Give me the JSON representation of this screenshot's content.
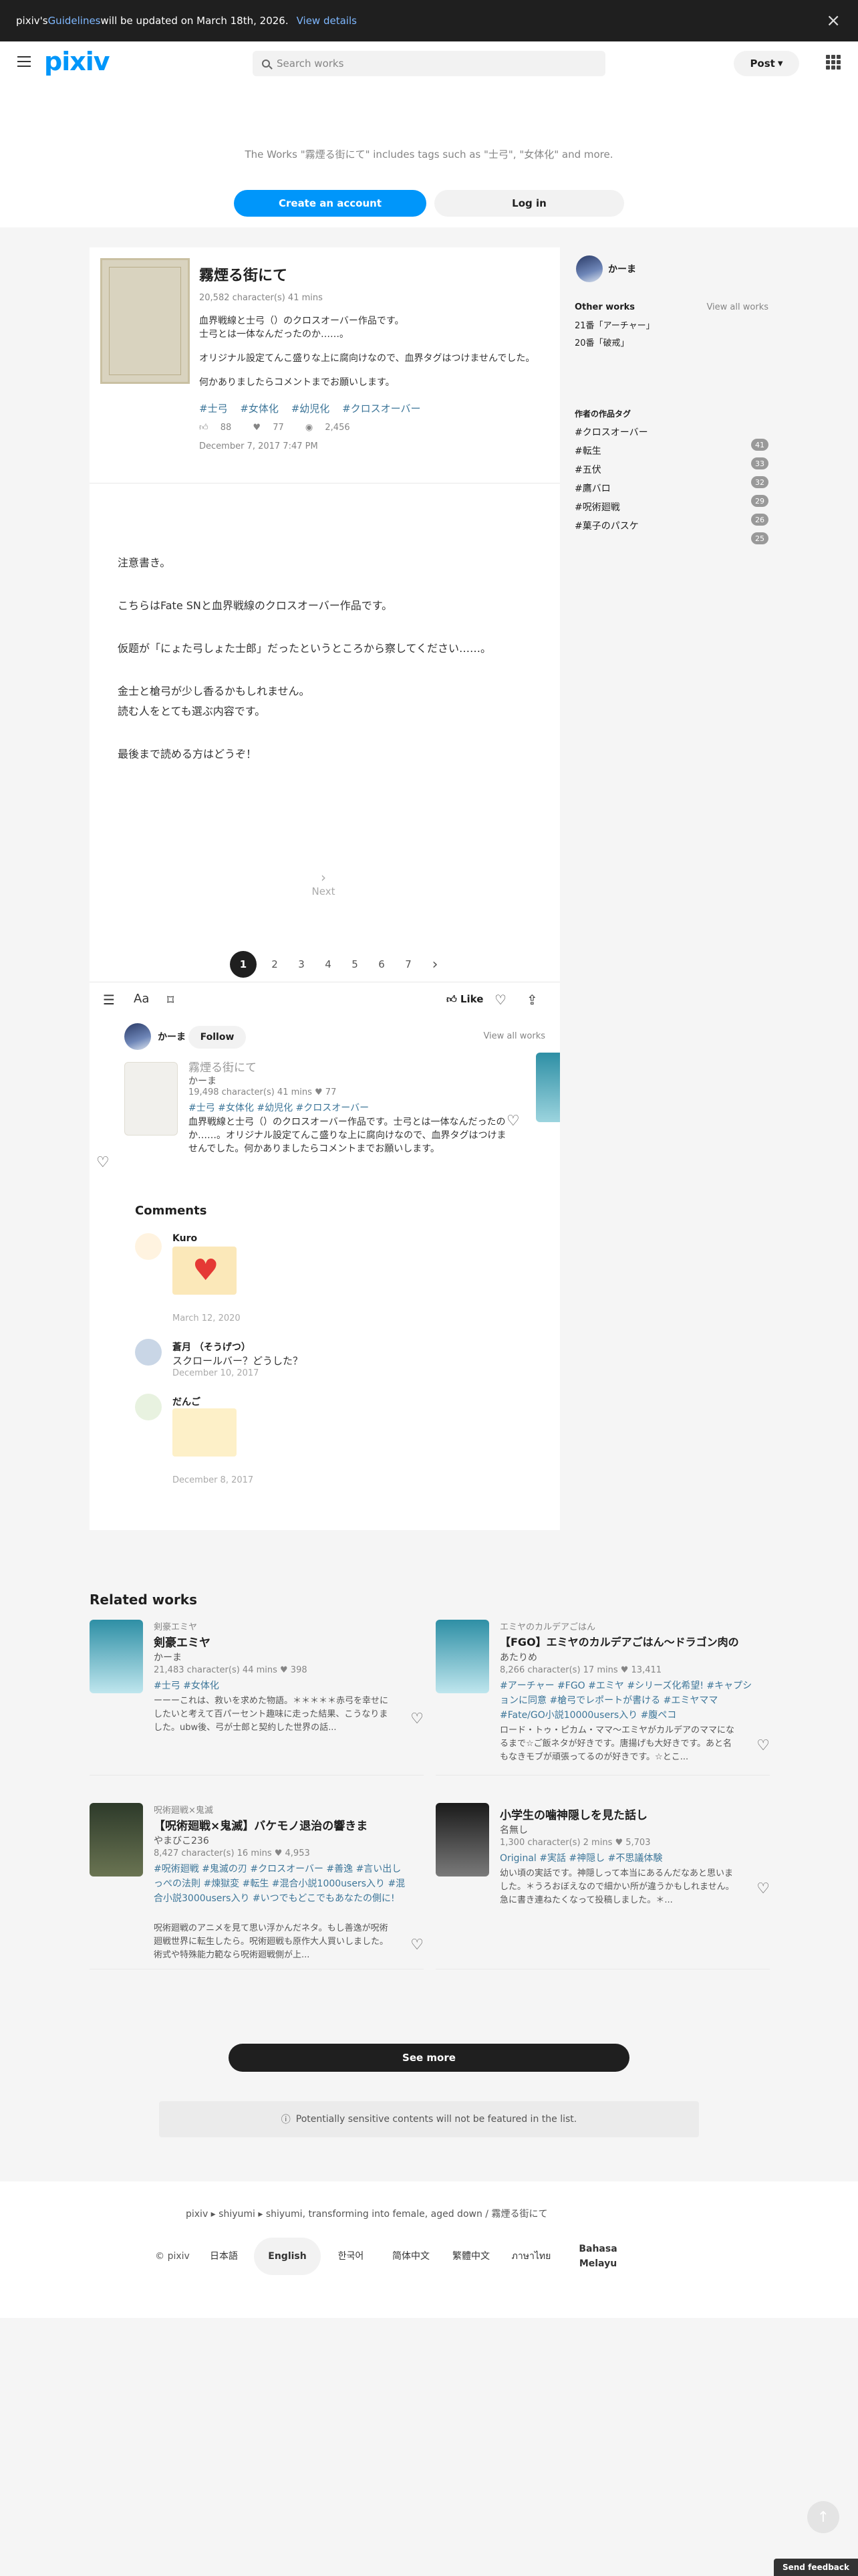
{
  "notice": {
    "prefix": "pixiv's ",
    "link": "Guidelines",
    "suffix": " will be updated on March 18th, 2026.",
    "details": "View details",
    "close": "×"
  },
  "header": {
    "logo": "pixiv",
    "search_placeholder": "Search works",
    "post": "Post"
  },
  "signup": {
    "text": "The Works \"霧煙る街にて\" includes tags such as \"士弓\", \"女体化\" and more.",
    "create": "Create an account",
    "login": "Log in"
  },
  "work": {
    "title": "霧煙る街にて",
    "meta": "20,582 character(s)  41 mins",
    "caption": [
      "血界戦線と士弓（）のクロスオーバー作品です。",
      "士弓とは一体なんだったのか……。",
      "オリジナル設定てんこ盛りな上に腐向けなので、血界タグはつけませんでした。",
      "何かありましたらコメントまでお願いします。"
    ],
    "tags": [
      "#士弓",
      "#女体化",
      "#幼児化",
      "#クロスオーバー"
    ],
    "likes": "88",
    "hearts": "77",
    "views": "2,456",
    "date": "December 7, 2017 7:47 PM",
    "body": [
      "注意書き。",
      "こちらはFate SNと血界戦線のクロスオーバー作品です。",
      "仮题が「にょた弓しょた士郎」だったというところから察してください……。",
      "金士と槍弓が少し香るかもしれません。",
      "読む人をとても選ぶ内容です。",
      "最後まで読める方はどうぞ！"
    ],
    "next": "Next",
    "pages": [
      "1",
      "2",
      "3",
      "4",
      "5",
      "6",
      "7"
    ],
    "like_label": "Like"
  },
  "author": {
    "name": "かーま",
    "follow": "Follow",
    "view_all": "View all works"
  },
  "mini": {
    "title": "霧煙る街にて",
    "author": "かーま",
    "meta": "19,498 character(s)  41 mins  ♥ 77",
    "tags": "#士弓  #女体化  #幼児化  #クロスオーバー",
    "desc": "血界戦線と士弓（）のクロスオーバー作品です。士弓とは一体なんだったのか……。オリジナル設定てんこ盛りな上に腐向けなので、血界タグはつけませんでした。何かありましたらコメントまでお願いします。"
  },
  "comments": {
    "heading": "Comments",
    "items": [
      {
        "name": "Kuro",
        "date": "March 12, 2020"
      },
      {
        "name": "蒼月 （そうげつ）",
        "text": "スクロールバー？どうした？",
        "date": "December 10, 2017"
      },
      {
        "name": "だんご",
        "date": "December 8, 2017"
      }
    ]
  },
  "side": {
    "name": "かーま",
    "other_works": "Other works",
    "view_all": "View all works",
    "works": [
      "21番「アーチャー」",
      "20番「破戒」"
    ],
    "tags_heading": "作者の作品タグ",
    "tags": [
      {
        "label": "#クロスオーバー",
        "count": "41"
      },
      {
        "label": "#転生",
        "count": "33"
      },
      {
        "label": "#五伏",
        "count": "32"
      },
      {
        "label": "#鷹バロ",
        "count": "29"
      },
      {
        "label": "#呪術廻戦",
        "count": "26"
      },
      {
        "label": "#菓子のパスケ",
        "count": "25"
      }
    ]
  },
  "related": {
    "heading": "Related works",
    "items": [
      {
        "series": "剣豪エミヤ",
        "title": "剣豪エミヤ",
        "author": "かーま",
        "meta": "21,483 character(s)  44 mins  ♥ 398",
        "tags": "#士弓  #女体化",
        "desc": "ーーーこれは、救いを求めた物語。＊＊＊＊＊赤弓を幸せにしたいと考えて百パーセント趣味に走った結果、こうなりました。ubw後、弓が士郎と契約した世界の話..."
      },
      {
        "series": "エミヤのカルデアごはん",
        "title": "【FGO】エミヤのカルデアごはん〜ドラゴン肉の",
        "author": "あたりめ",
        "meta": "8,266 character(s)  17 mins  ♥ 13,411",
        "tags": "#アーチャー  #FGO  #エミヤ  #シリーズ化希望!  #キャプションに同意  #槍弓でレポートが書ける  #エミヤママ  #Fate/GO小説10000users入り  #腹ペコ",
        "desc": "ロード・トゥ・ピカム・ママ〜エミヤがカルデアのママになるまで☆ご飯ネタが好きです。唐揚げも大好きです。あと名もなきモブが頑張ってるのが好きです。☆とこ..."
      },
      {
        "series": "呪術廻戦×鬼滅",
        "title": "【呪術廻戦×鬼滅】バケモノ退治の響きま",
        "author": "やまびこ236",
        "meta": "8,427 character(s)  16 mins  ♥ 4,953",
        "tags": "#呪術廻戦  #鬼滅の刃  #クロスオーバー  #善逸  #言い出しっぺの法則  #煉獄変  #転生  #混合小説1000users入り  #混合小説3000users入り  #いつでもどこでもあなたの側に!",
        "desc": "呪術廻戦のアニメを見て思い浮かんだネタ。もし善逸が呪術廻戦世界に転生したら。呪術廻戦も原作大人買いしました。術式や特殊能力範なら呪術廻戦側が上..."
      },
      {
        "series": "",
        "title": "小学生の噛神隠しを見た話し",
        "author": "名無し",
        "meta": "1,300 character(s)  2 mins  ♥ 5,703",
        "tags": "Original  #実話  #神隠し  #不思議体験",
        "desc": "幼い頃の実話です。神隠しって本当にあるんだなあと思いました。＊うろおぼえなので細かい所が違うかもしれません。急に書き連ねたくなって投稿しました。＊..."
      }
    ],
    "see_more": "See more",
    "sensitive": "Potentially sensitive contents will not be featured in the list."
  },
  "footer": {
    "crumb": "pixiv  ▸  shiyumi  ▸  shiyumi, transforming into female, aged down / 霧煙る街にて",
    "copyright": "© pixiv",
    "langs": [
      "日本語",
      "English",
      "한국어",
      "简体中文",
      "繁體中文",
      "ภาษาไทย",
      "Bahasa Melayu"
    ],
    "feedback": "Send feedback"
  }
}
